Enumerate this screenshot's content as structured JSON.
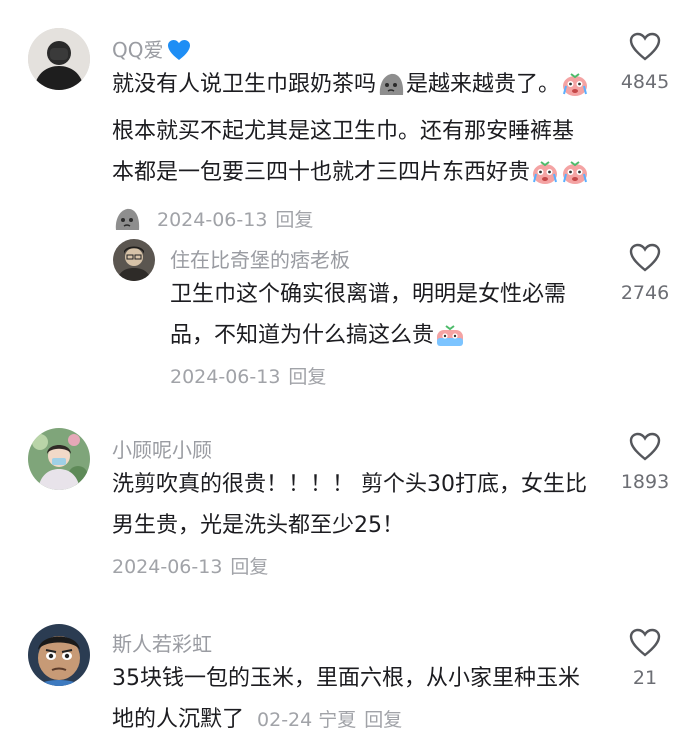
{
  "comments": [
    {
      "user": "QQ爱",
      "text_a": "就没有人说卫生巾跟奶茶吗",
      "text_b": "是越来越贵了。",
      "text_c": "根本就买不起尤其是这卫生巾。还有那安睡裤基本都是一包要三四十也就才三四片东西好贵",
      "date": "2024-06-13",
      "reply": "回复",
      "likes": "4845"
    },
    {
      "user": "住在比奇堡的痞老板",
      "text_a": "卫生巾这个确实很离谱，明明是女性必需品，不知道为什么搞这么贵",
      "date": "2024-06-13",
      "reply": "回复",
      "likes": "2746"
    },
    {
      "user": "小顾呢小顾",
      "text_a": "洗剪吹真的很贵！！！！ 剪个头30打底，女生比男生贵，光是洗头都至少25！",
      "date": "2024-06-13",
      "reply": "回复",
      "likes": "1893"
    },
    {
      "user": "斯人若彩虹",
      "text_a": "35块钱一包的玉米，里面六根，从小家里种玉米地的人沉默了",
      "date": "02-24",
      "location": "宁夏",
      "reply": "回复",
      "likes": "21"
    }
  ],
  "icons": {
    "like": "heart-outline-icon",
    "blue_heart": "blue-heart-icon",
    "cry": "crying-face-emoji",
    "rock": "rock-emoji",
    "shocked": "shocked-face-emoji"
  },
  "colors": {
    "username": "#9a9ca2",
    "text": "#1c1c20",
    "meta": "#a1a3a8",
    "blue_heart": "#1e8ef5"
  }
}
